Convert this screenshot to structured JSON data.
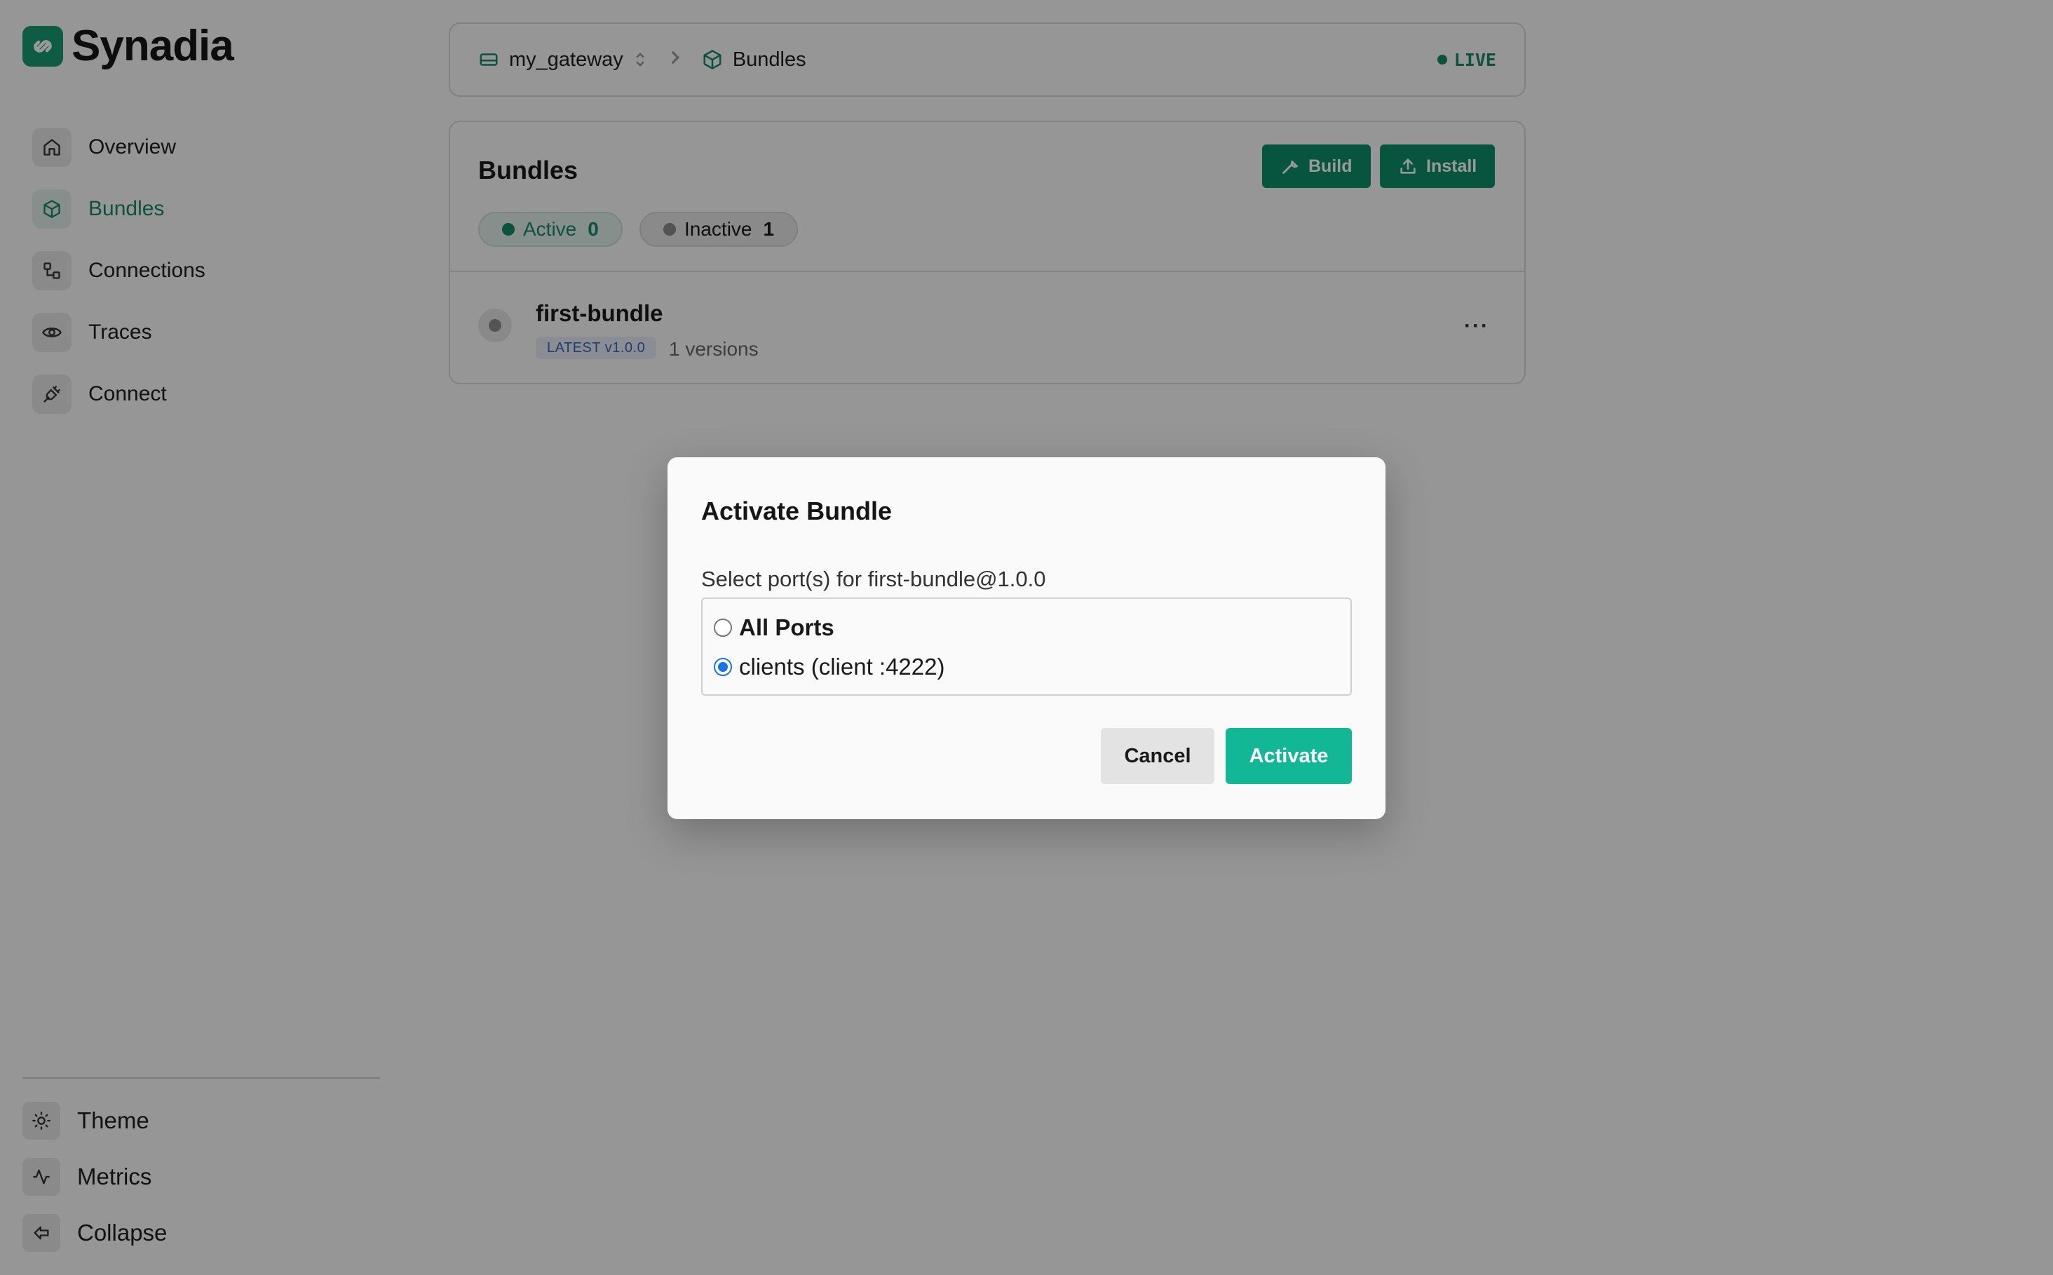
{
  "brand": {
    "name": "Synadia"
  },
  "sidebar": {
    "items": [
      {
        "label": "Overview",
        "icon": "home-icon"
      },
      {
        "label": "Bundles",
        "icon": "package-icon"
      },
      {
        "label": "Connections",
        "icon": "connections-icon"
      },
      {
        "label": "Traces",
        "icon": "eye-icon"
      },
      {
        "label": "Connect",
        "icon": "plug-icon"
      }
    ],
    "bottom": [
      {
        "label": "Theme",
        "icon": "sun-icon"
      },
      {
        "label": "Metrics",
        "icon": "activity-icon"
      },
      {
        "label": "Collapse",
        "icon": "collapse-icon"
      }
    ],
    "active_item": "Bundles"
  },
  "header": {
    "gateway": "my_gateway",
    "page": "Bundles",
    "status": "LIVE"
  },
  "bundles_panel": {
    "title": "Bundles",
    "build_label": "Build",
    "install_label": "Install",
    "filters": [
      {
        "label": "Active",
        "count": "0"
      },
      {
        "label": "Inactive",
        "count": "1"
      }
    ],
    "rows": [
      {
        "name": "first-bundle",
        "tag": "LATEST v1.0.0",
        "versions": "1 versions",
        "more": "···"
      }
    ]
  },
  "modal": {
    "title": "Activate Bundle",
    "subtitle": "Select port(s) for first-bundle@1.0.0",
    "options": [
      {
        "label": "All Ports",
        "checked": false
      },
      {
        "label": "clients (client :4222)",
        "checked": true
      }
    ],
    "cancel_label": "Cancel",
    "activate_label": "Activate"
  },
  "colors": {
    "accent": "#16876a",
    "button_green": "#0d8e6a",
    "activate_green": "#12b895",
    "radio_blue": "#1a73e8"
  }
}
